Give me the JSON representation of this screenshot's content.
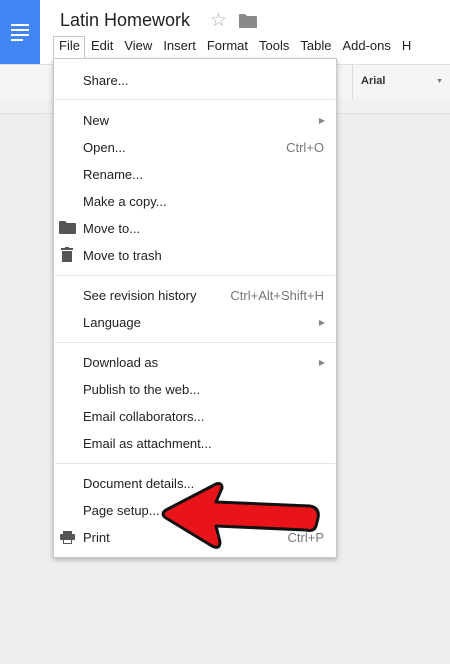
{
  "app": {
    "title": "Latin Homework",
    "logo_icon": "docs-logo-icon",
    "star_icon": "star-outline-icon",
    "folder_icon": "folder-icon",
    "brand_color": "#4285f4"
  },
  "menubar": {
    "items": [
      "File",
      "Edit",
      "View",
      "Insert",
      "Format",
      "Tools",
      "Table",
      "Add-ons",
      "H"
    ]
  },
  "toolbar": {
    "font": "Arial"
  },
  "file_menu": {
    "share": "Share...",
    "new": "New",
    "open": "Open...",
    "open_shortcut": "Ctrl+O",
    "rename": "Rename...",
    "make_copy": "Make a copy...",
    "move_to": "Move to...",
    "move_to_trash": "Move to trash",
    "revision_history": "See revision history",
    "revision_history_shortcut": "Ctrl+Alt+Shift+H",
    "language": "Language",
    "download_as": "Download as",
    "publish": "Publish to the web...",
    "email_collaborators": "Email collaborators...",
    "email_attachment": "Email as attachment...",
    "document_details": "Document details...",
    "page_setup": "Page setup...",
    "print": "Print",
    "print_shortcut": "Ctrl+P"
  },
  "annotation": {
    "arrow_color": "#e8141a",
    "points_to": "page_setup"
  }
}
